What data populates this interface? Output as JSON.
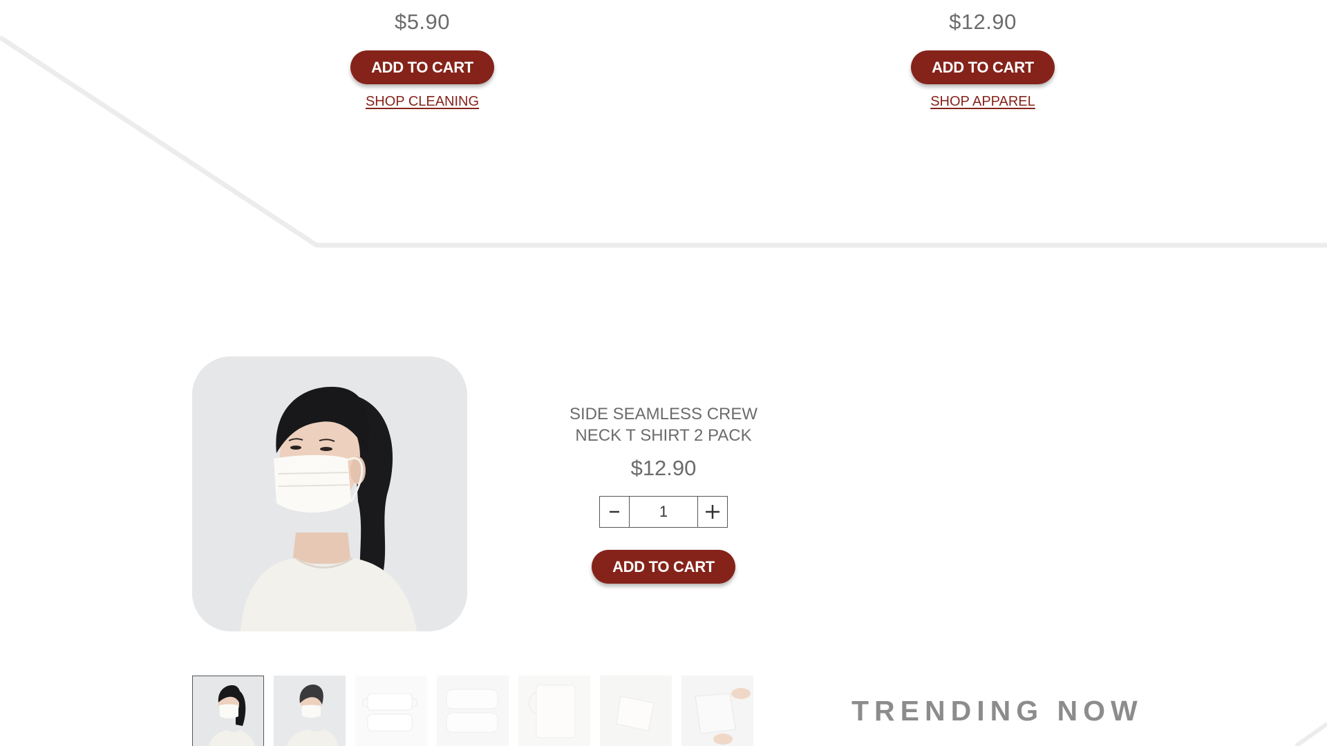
{
  "products_top": [
    {
      "price": "$5.90",
      "cart_label": "ADD TO CART",
      "shop_link": "SHOP CLEANING"
    },
    {
      "price": "$12.90",
      "cart_label": "ADD TO CART",
      "shop_link": "SHOP APPAREL"
    }
  ],
  "featured": {
    "title": "SIDE SEAMLESS CREW NECK T SHIRT 2 PACK",
    "price": "$12.90",
    "quantity": "1",
    "minus_symbol": "−",
    "plus_symbol": "+",
    "cart_label": "ADD TO CART",
    "thumbnails_count": 7,
    "active_thumbnail": 1
  },
  "trending_heading": "TRENDING NOW",
  "colors": {
    "accent": "#85231a",
    "text_gray": "#6b6b6b",
    "heading_gray": "#8c8c8c",
    "deco_line": "#ececec"
  }
}
